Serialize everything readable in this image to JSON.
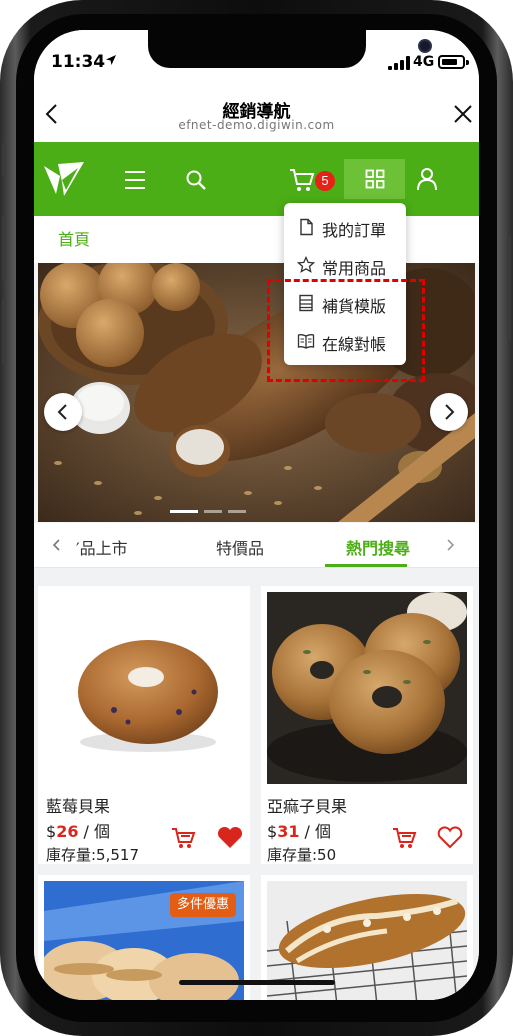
{
  "status_bar": {
    "time": "11:34",
    "network": "4G"
  },
  "web_header": {
    "title": "經銷導航",
    "url": "efnet-demo.digiwin.com"
  },
  "nav": {
    "cart_count": "5"
  },
  "dropdown": {
    "items": [
      {
        "label": "我的訂單",
        "icon": "document-icon"
      },
      {
        "label": "常用商品",
        "icon": "star-icon"
      },
      {
        "label": "補貨模版",
        "icon": "list-icon"
      },
      {
        "label": "在線對帳",
        "icon": "book-icon"
      }
    ]
  },
  "breadcrumb": {
    "home": "首頁"
  },
  "tabs": {
    "items": [
      "′品上市",
      "特價品",
      "熱門搜尋"
    ],
    "active_index": 2
  },
  "products": [
    {
      "name": "藍莓貝果",
      "price": "26",
      "unit": " / 個",
      "stock": "庫存量:5,517",
      "favorited": true
    },
    {
      "name": "亞痲子貝果",
      "price": "31",
      "unit": " / 個",
      "stock": "庫存量:50",
      "favorited": false
    },
    {
      "name": "",
      "badge": "多件優惠"
    },
    {
      "name": ""
    }
  ],
  "currency": "$",
  "colors": {
    "brand_green": "#4cae16",
    "price_red": "#d8261c",
    "badge_red": "#e52218",
    "promo_orange": "#e35d14"
  }
}
